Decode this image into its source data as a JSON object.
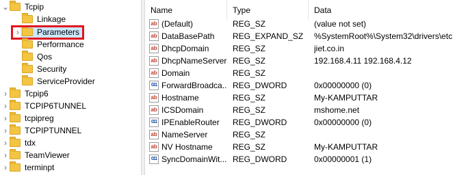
{
  "tree": {
    "items": [
      {
        "label": "Tcpip",
        "expanded": true,
        "level": 0,
        "chevron": "chevron-down-icon"
      },
      {
        "label": "Linkage",
        "level": 1
      },
      {
        "label": "Parameters",
        "level": 1,
        "selected": true,
        "chevron": "chevron-right-icon"
      },
      {
        "label": "Performance",
        "level": 1
      },
      {
        "label": "Qos",
        "level": 1
      },
      {
        "label": "Security",
        "level": 1
      },
      {
        "label": "ServiceProvider",
        "level": 1
      },
      {
        "label": "Tcpip6",
        "level": 0,
        "chevron": "chevron-right-icon"
      },
      {
        "label": "TCPIP6TUNNEL",
        "level": 0,
        "chevron": "chevron-right-icon"
      },
      {
        "label": "tcpipreg",
        "level": 0,
        "chevron": "chevron-right-icon"
      },
      {
        "label": "TCPIPTUNNEL",
        "level": 0,
        "chevron": "chevron-right-icon"
      },
      {
        "label": "tdx",
        "level": 0,
        "chevron": "chevron-right-icon"
      },
      {
        "label": "TeamViewer",
        "level": 0,
        "chevron": "chevron-right-icon"
      },
      {
        "label": "terminpt",
        "level": 0,
        "chevron": "chevron-right-icon"
      }
    ]
  },
  "list": {
    "columns": [
      "Name",
      "Type",
      "Data"
    ],
    "rows": [
      {
        "name": "(Default)",
        "type": "REG_SZ",
        "data": "(value not set)",
        "icon": "string-value-icon"
      },
      {
        "name": "DataBasePath",
        "type": "REG_EXPAND_SZ",
        "data": "%SystemRoot%\\System32\\drivers\\etc",
        "icon": "string-value-icon"
      },
      {
        "name": "DhcpDomain",
        "type": "REG_SZ",
        "data": "jiet.co.in",
        "icon": "string-value-icon"
      },
      {
        "name": "DhcpNameServer",
        "type": "REG_SZ",
        "data": "192.168.4.11 192.168.4.12",
        "icon": "string-value-icon"
      },
      {
        "name": "Domain",
        "type": "REG_SZ",
        "data": "",
        "icon": "string-value-icon"
      },
      {
        "name": "ForwardBroadca...",
        "type": "REG_DWORD",
        "data": "0x00000000 (0)",
        "icon": "binary-value-icon"
      },
      {
        "name": "Hostname",
        "type": "REG_SZ",
        "data": "My-KAMPUTTAR",
        "icon": "string-value-icon"
      },
      {
        "name": "ICSDomain",
        "type": "REG_SZ",
        "data": "mshome.net",
        "icon": "string-value-icon"
      },
      {
        "name": "IPEnableRouter",
        "type": "REG_DWORD",
        "data": "0x00000000 (0)",
        "icon": "binary-value-icon"
      },
      {
        "name": "NameServer",
        "type": "REG_SZ",
        "data": "",
        "icon": "string-value-icon"
      },
      {
        "name": "NV Hostname",
        "type": "REG_SZ",
        "data": "My-KAMPUTTAR",
        "icon": "string-value-icon"
      },
      {
        "name": "SyncDomainWit...",
        "type": "REG_DWORD",
        "data": "0x00000001 (1)",
        "icon": "binary-value-icon"
      }
    ]
  },
  "icons": {
    "sz": "ab",
    "dw": "011"
  },
  "colors": {
    "selection": "#cce8ff",
    "highlight_box": "#e0141e",
    "folder": "#f4c542"
  }
}
